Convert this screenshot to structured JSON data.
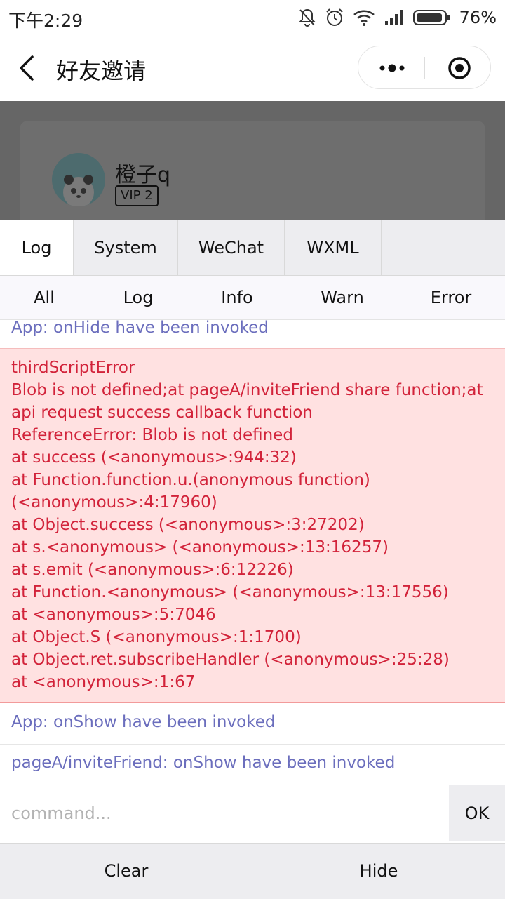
{
  "status_bar": {
    "time": "下午2:29",
    "battery": "76%",
    "icons": [
      "mute-bell-icon",
      "alarm-icon",
      "wifi-icon",
      "signal-icon",
      "battery-icon"
    ]
  },
  "nav": {
    "title": "好友邀请",
    "back_icon": "back-arrow-icon",
    "more_icon": "more-dots-icon",
    "close_icon": "target-close-icon"
  },
  "profile": {
    "name": "橙子q",
    "badge": "VIP 2"
  },
  "console": {
    "tabs": [
      {
        "label": "Log",
        "active": true
      },
      {
        "label": "System",
        "active": false
      },
      {
        "label": "WeChat",
        "active": false
      },
      {
        "label": "WXML",
        "active": false
      }
    ],
    "filters": [
      "All",
      "Log",
      "Info",
      "Warn",
      "Error"
    ],
    "logs": {
      "first": "App: onHide have been invoked",
      "error_lines": [
        "thirdScriptError",
        "Blob is not defined;at pageA/inviteFriend share function;at",
        "api request success callback function",
        "ReferenceError: Blob is not defined",
        "at success (<anonymous>:944:32)",
        "at Function.function.u.(anonymous function)",
        "(<anonymous>:4:17960)",
        "at Object.success (<anonymous>:3:27202)",
        "at s.<anonymous> (<anonymous>:13:16257)",
        "at s.emit (<anonymous>:6:12226)",
        "at Function.<anonymous> (<anonymous>:13:17556)",
        "at <anonymous>:5:7046",
        "at Object.S (<anonymous>:1:1700)",
        "at Object.ret.subscribeHandler (<anonymous>:25:28)",
        "at <anonymous>:1:67"
      ],
      "after": [
        "App: onShow have been invoked",
        "pageA/inviteFriend: onShow have been invoked"
      ]
    },
    "command": {
      "placeholder": "command...",
      "value": "",
      "ok_label": "OK"
    },
    "bottom": {
      "clear_label": "Clear",
      "hide_label": "Hide"
    }
  },
  "colors": {
    "info_text": "#6b6ebd",
    "error_text": "#d2233a",
    "error_bg": "#ffe1e1",
    "overlay": "#666666"
  }
}
